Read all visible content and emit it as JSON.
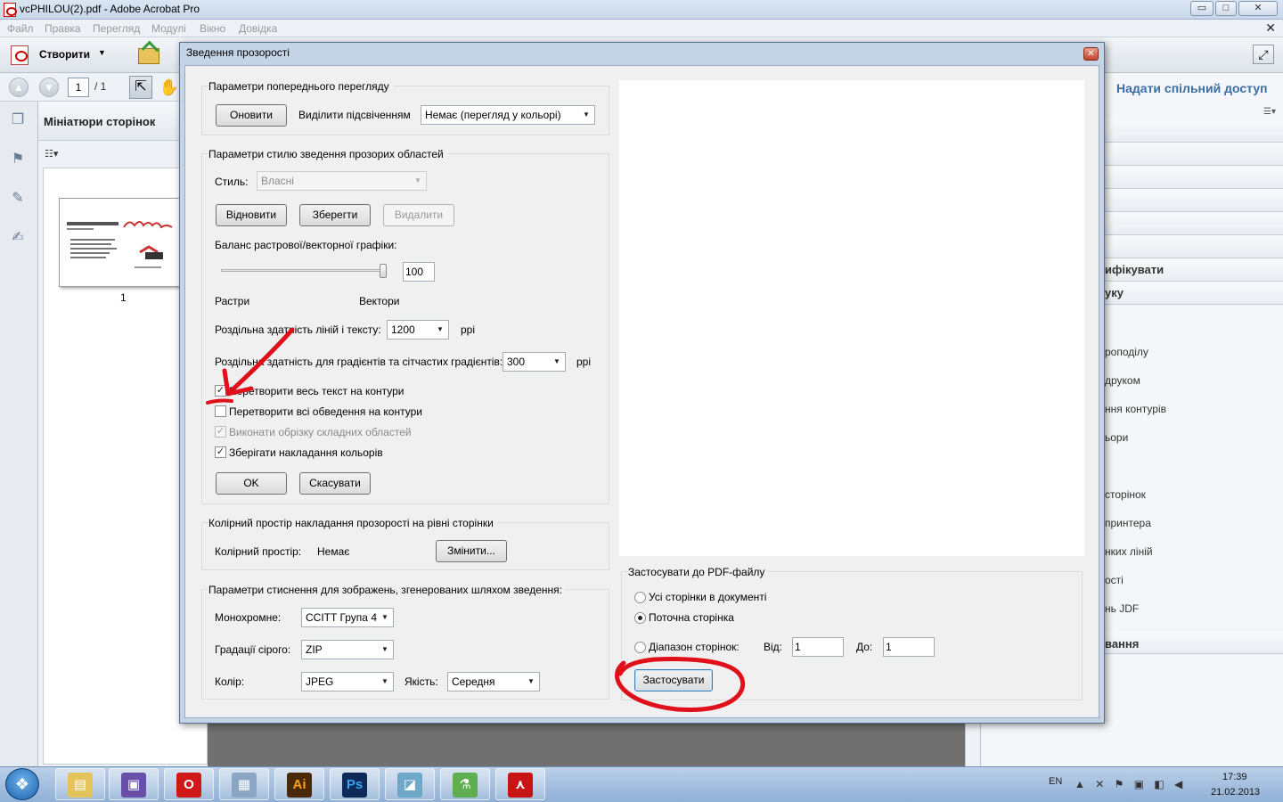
{
  "window": {
    "title": "vcPHILOU(2).pdf - Adobe Acrobat Pro",
    "minimize": "▭",
    "maximize": "□",
    "close": "✕"
  },
  "menu": [
    "Файл",
    "Правка",
    "Перегляд",
    "Модулі",
    "Вікно",
    "Довідка"
  ],
  "toolbar": {
    "create_label": "Створити",
    "create_arrow": "▼"
  },
  "nav": {
    "page_current": "1",
    "page_total": "/ 1",
    "up_arrow": "▲",
    "down_arrow": "▼",
    "select_glyph": "⇱",
    "hand_glyph": "✋"
  },
  "thumbs": {
    "title": "Мініатюри сторінок",
    "options_glyph": "☷▾",
    "page_label": "1"
  },
  "right_pane": {
    "share": "Надати спільний доступ",
    "heading1": "ифікувати",
    "heading2": "уку",
    "items": [
      "роподілу",
      "друком",
      "ння контурів",
      "ьори",
      "сторінок",
      "принтера",
      "нких ліній",
      "ості",
      "нь JDF"
    ],
    "heading3": "вання"
  },
  "dialog": {
    "title": "Зведення прозорості",
    "close_glyph": "✕",
    "preview_group": {
      "label": "Параметри попереднього перегляду",
      "refresh_button": "Оновити",
      "highlight_label": "Виділити підсвіченням",
      "highlight_value": "Немає (перегляд у кольорі)"
    },
    "style_group": {
      "label": "Параметри стилю зведення прозорих областей",
      "style_label": "Стиль:",
      "style_value": "Власні",
      "restore_button": "Відновити",
      "save_button": "Зберегти",
      "delete_button": "Видалити",
      "balance_label": "Баланс растрової/векторної графіки:",
      "balance_value": "100",
      "balance_fraction": 1.0,
      "raster_label": "Растри",
      "vector_label": "Вектори",
      "line_res_label": "Роздільна здатність ліній і тексту:",
      "line_res_value": "1200",
      "ppi1": "ppi",
      "gradient_res_label": "Роздільна здатність для градієнтів та сітчастих градієнтів:",
      "gradient_res_value": "300",
      "ppi2": "ppi",
      "checkboxes": [
        {
          "label": "Перетворити весь текст на контури",
          "checked": true,
          "disabled": false
        },
        {
          "label": "Перетворити всі обведення на контури",
          "checked": false,
          "disabled": false
        },
        {
          "label": "Виконати обрізку складних областей",
          "checked": true,
          "disabled": true
        },
        {
          "label": "Зберігати накладання кольорів",
          "checked": true,
          "disabled": false
        }
      ],
      "ok_button": "OK",
      "cancel_button": "Скасувати"
    },
    "colorspace_group": {
      "label": "Колірний простір накладання прозорості на рівні сторінки",
      "cs_label": "Колірний простір:",
      "cs_value": "Немає",
      "change_button": "Змінити..."
    },
    "compression_group": {
      "label": "Параметри стиснення для зображень, згенерованих шляхом зведення:",
      "mono_label": "Монохромне:",
      "mono_value": "CCITT Група 4",
      "gray_label": "Градації сірого:",
      "gray_value": "ZIP",
      "color_label": "Колір:",
      "color_value": "JPEG",
      "quality_label": "Якість:",
      "quality_value": "Середня"
    },
    "apply_group": {
      "label": "Застосувати до PDF-файлу",
      "all_pages": "Усі сторінки в документі",
      "current_page": "Поточна сторінка",
      "range": "Діапазон сторінок:",
      "from_label": "Від:",
      "from_value": "1",
      "to_label": "До:",
      "to_value": "1",
      "selected": "current_page",
      "apply_button": "Застосувати"
    }
  },
  "taskbar": {
    "start_glyph": "❖",
    "apps": [
      {
        "name": "explorer",
        "glyph": "▤",
        "color": "#e3c35a"
      },
      {
        "name": "save",
        "glyph": "▣",
        "color": "#6a4fa8"
      },
      {
        "name": "opera",
        "glyph": "O",
        "color": "#d01818"
      },
      {
        "name": "calculator",
        "glyph": "▦",
        "color": "#8aa6c4"
      },
      {
        "name": "illustrator",
        "glyph": "Ai",
        "color": "#4a2a06"
      },
      {
        "name": "photoshop",
        "glyph": "Ps",
        "color": "#0d2a58"
      },
      {
        "name": "app7",
        "glyph": "◪",
        "color": "#6fa7c9"
      },
      {
        "name": "app8",
        "glyph": "⚗",
        "color": "#5fae4f"
      },
      {
        "name": "acrobat",
        "glyph": "⋏",
        "color": "#c81414"
      }
    ],
    "lang": "EN",
    "tray": "▲ ✕ ⚑ ▣ ◧ ◀",
    "time": "17:39",
    "date": "21.02.2013"
  },
  "colors": {
    "annotation_red": "#e0101a",
    "link_blue": "#3a6ea5"
  }
}
